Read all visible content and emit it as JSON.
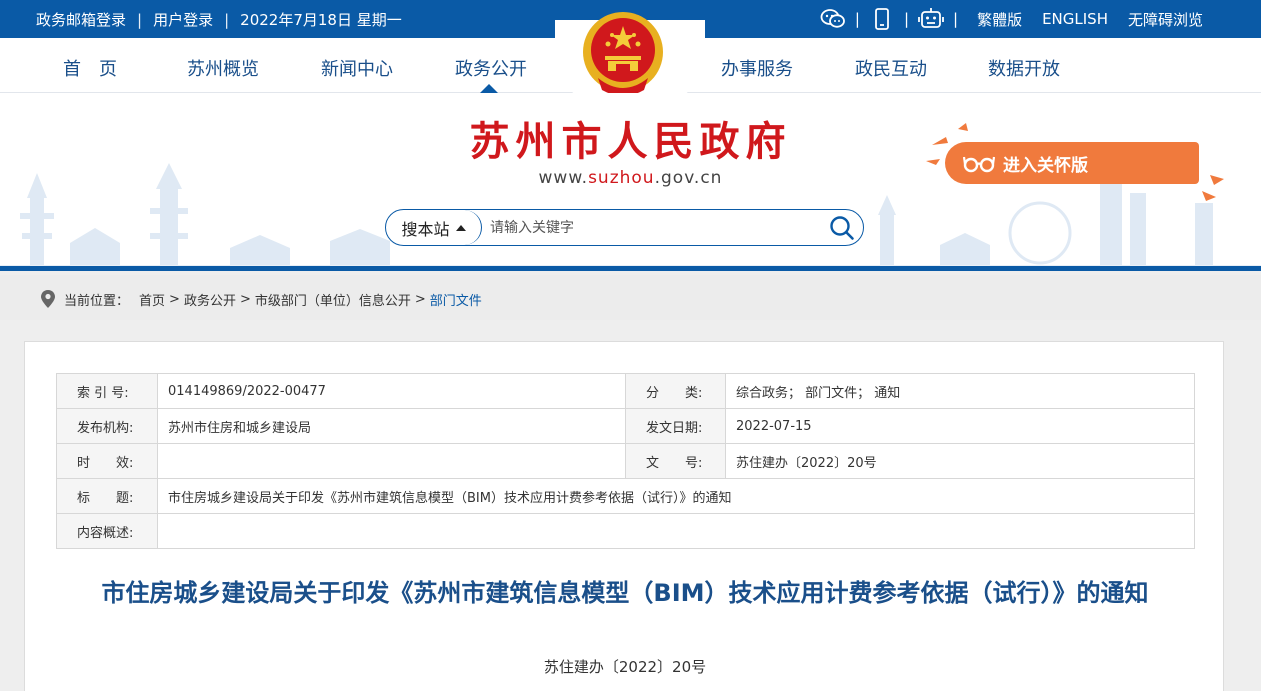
{
  "topbar": {
    "left_links": [
      "政务邮箱登录",
      "用户登录",
      "2022年7月18日 星期一"
    ],
    "separator": "|",
    "right_links": [
      "繁體版",
      "ENGLISH",
      "无障碍浏览"
    ],
    "icons": [
      "wechat-icon",
      "mobile-icon",
      "robot-icon"
    ]
  },
  "nav": {
    "items": [
      "首　页",
      "苏州概览",
      "新闻中心",
      "政务公开",
      "办事服务",
      "政民互动",
      "数据开放"
    ],
    "active_index": 3
  },
  "header": {
    "title": "苏州市人民政府",
    "url_prefix": "www.",
    "url_highlight": "suzhou",
    "url_suffix": ".gov.cn",
    "care_button": "进入关怀版"
  },
  "search": {
    "scope_label": "搜本站",
    "placeholder": "请输入关键字"
  },
  "breadcrumb": {
    "label": "当前位置：",
    "items": [
      "首页",
      "政务公开",
      "市级部门（单位）信息公开",
      "部门文件"
    ],
    "sep": ">"
  },
  "meta": {
    "index_label": "索 引 号:",
    "index_value": "014149869/2022-00477",
    "category_label": "分　　类:",
    "category_value": "综合政务；  部门文件；  通知",
    "org_label": "发布机构:",
    "org_value": "苏州市住房和城乡建设局",
    "date_label": "发文日期:",
    "date_value": "2022-07-15",
    "validity_label": "时　　效:",
    "validity_value": "",
    "docno_label": "文　　号:",
    "docno_value": "苏住建办〔2022〕20号",
    "subject_label": "标　　题:",
    "subject_value": "市住房城乡建设局关于印发《苏州市建筑信息模型（BIM）技术应用计费参考依据（试行）》的通知",
    "summary_label": "内容概述:",
    "summary_value": ""
  },
  "document": {
    "title": "市住房城乡建设局关于印发《苏州市建筑信息模型（BIM）技术应用计费参考依据（试行）》的通知",
    "number": "苏住建办〔2022〕20号"
  },
  "colors": {
    "primary_blue": "#0a5aa6",
    "title_red": "#d0181c",
    "care_orange": "#f07a3d"
  }
}
